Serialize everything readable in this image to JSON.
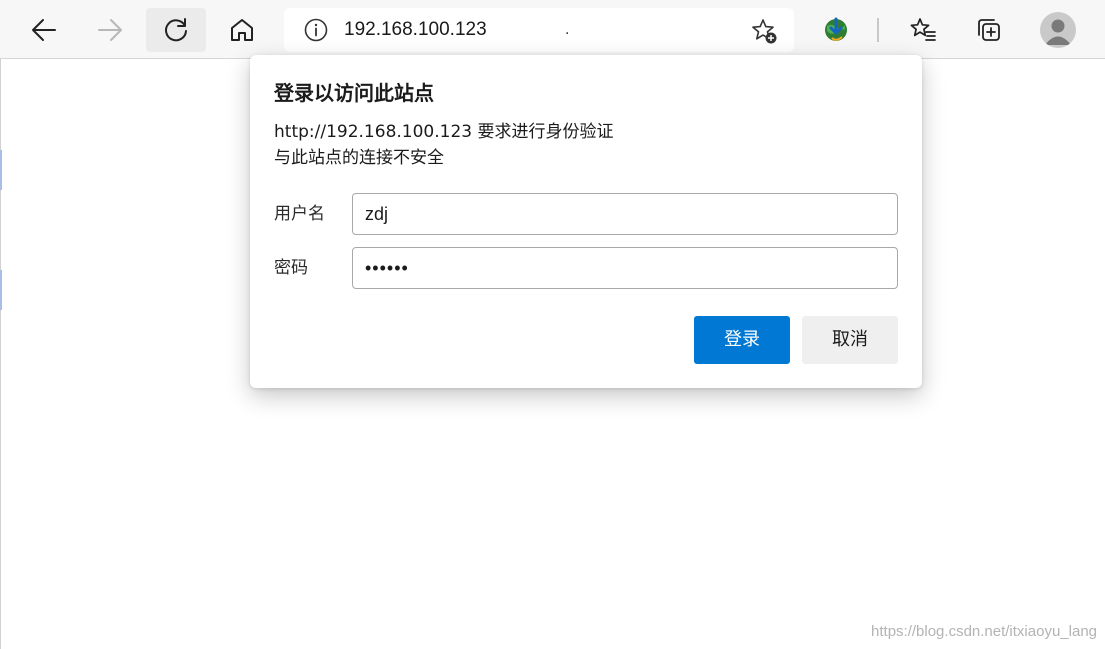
{
  "toolbar": {
    "back_icon": "arrow-left-icon",
    "forward_icon": "arrow-right-icon",
    "refresh_icon": "refresh-icon",
    "home_icon": "home-icon",
    "favorites_icon": "favorites-list-icon",
    "collections_icon": "collections-icon",
    "extension_icon": "globe-extension-icon",
    "profile_icon": "avatar-icon"
  },
  "address_bar": {
    "url": "192.168.100.123",
    "trailing_char": ".",
    "info_icon": "info-icon",
    "add_favorite_icon": "star-add-icon"
  },
  "dialog": {
    "title": "登录以访问此站点",
    "message_line1": "http://192.168.100.123 要求进行身份验证",
    "message_line2": "与此站点的连接不安全",
    "username_label": "用户名",
    "username_value": "zdj",
    "password_label": "密码",
    "password_value": "••••••",
    "login_button": "登录",
    "cancel_button": "取消"
  },
  "watermark": "https://blog.csdn.net/itxiaoyu_lang",
  "colors": {
    "primary": "#0078d4",
    "toolbar_bg": "#f7f7f7"
  }
}
